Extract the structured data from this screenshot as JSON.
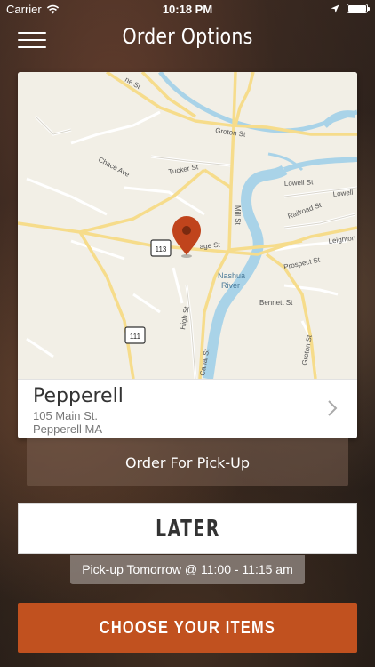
{
  "status_bar": {
    "carrier": "Carrier",
    "time": "10:18 PM",
    "icons": [
      "wifi-icon",
      "location-arrow-icon",
      "battery-icon"
    ]
  },
  "nav": {
    "title": "Order Options",
    "menu_icon": "hamburger-icon"
  },
  "map": {
    "labels": {
      "street_top": "ne St",
      "groton_st": "Groton St",
      "chace_ave": "Chace Ave",
      "tucker_st": "Tucker St",
      "mill_st": "Mill St",
      "lowell_st": "Lowell St",
      "lowell_st_2": "Lowell",
      "railroad_st": "Railroad St",
      "village_st": "age St",
      "leighton_st": "Leighton",
      "prospect_st": "Prospect St",
      "nashua_river_1": "Nashua",
      "nashua_river_2": "River",
      "high_st": "High St",
      "bennett_st": "Bennett St",
      "canal_st": "Canal St",
      "groton_st_2": "Groton St",
      "route_113": "113",
      "route_111": "111"
    },
    "pin_icon": "map-pin-icon",
    "colors": {
      "pin": "#c0441c",
      "water": "#a9d3e8",
      "road_major": "#f6dc8b",
      "land": "#f2efe6"
    }
  },
  "location": {
    "name": "Pepperell",
    "address_line1": "105 Main St.",
    "address_line2": "Pepperell MA",
    "chevron_icon": "chevron-right-icon"
  },
  "pickup_mode": {
    "label": "Order For Pick-Up"
  },
  "timing": {
    "later_label": "LATER",
    "pickup_time": "Pick-up Tomorrow @ 11:00 - 11:15 am"
  },
  "cta": {
    "label": "CHOOSE YOUR ITEMS",
    "color": "#c1511f"
  }
}
